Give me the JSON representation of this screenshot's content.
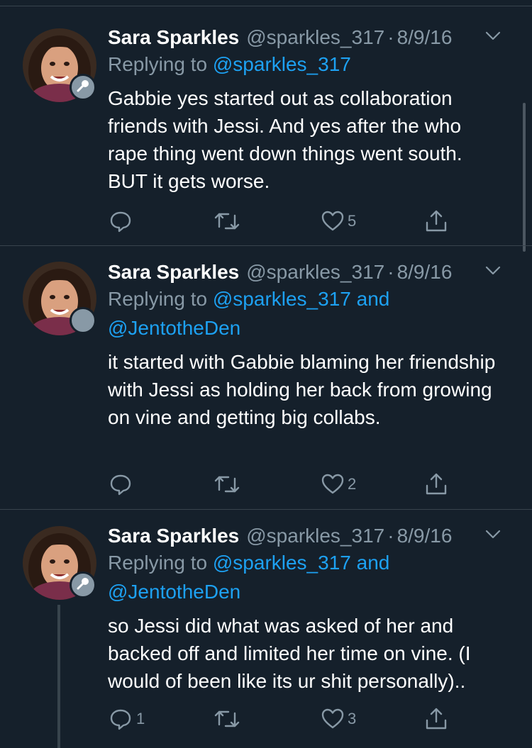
{
  "tweets": [
    {
      "name": "Sara Sparkles",
      "handle": "@sparkles_317",
      "separator": "·",
      "date": "8/9/16",
      "replying_prefix": "Replying to",
      "mentions_line1": "@sparkles_317",
      "mentions_line2": "",
      "body": "Gabbie yes started out as collaboration friends with Jessi. And yes after the who rape thing went down things went south. BUT it gets worse.",
      "reply_count": "",
      "retweet_count": "",
      "like_count": "5"
    },
    {
      "name": "Sara Sparkles",
      "handle": "@sparkles_317",
      "separator": "·",
      "date": "8/9/16",
      "replying_prefix": "Replying to",
      "mentions_line1": "@sparkles_317 and",
      "mentions_line2": "@JentotheDen",
      "body": "it started with Gabbie blaming her friendship with Jessi as holding her back from growing on vine and getting big collabs.",
      "reply_count": "",
      "retweet_count": "",
      "like_count": "2"
    },
    {
      "name": "Sara Sparkles",
      "handle": "@sparkles_317",
      "separator": "·",
      "date": "8/9/16",
      "replying_prefix": "Replying to",
      "mentions_line1": "@sparkles_317 and",
      "mentions_line2": "@JentotheDen",
      "body": "so Jessi did what was asked of her and backed off and limited her time on vine. (I would of been like its ur shit personally)..",
      "reply_count": "1",
      "retweet_count": "",
      "like_count": "3"
    }
  ],
  "colors": {
    "background": "#15202b",
    "divider": "#38444d",
    "secondary_text": "#8899a6",
    "link": "#1da1f2"
  },
  "icons": [
    "mic-icon",
    "chevron-down-icon",
    "reply-icon",
    "retweet-icon",
    "like-icon",
    "share-icon"
  ]
}
